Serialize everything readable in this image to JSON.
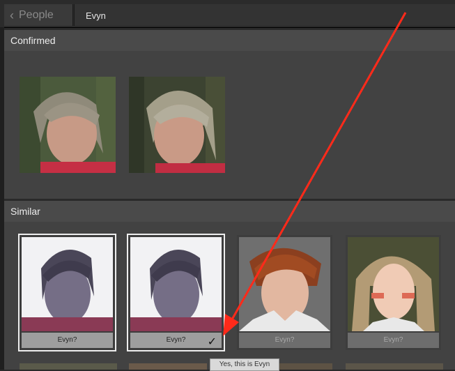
{
  "header": {
    "back_label": "People",
    "title": "Evyn"
  },
  "confirmed": {
    "heading": "Confirmed",
    "count": 2
  },
  "similar": {
    "heading": "Similar",
    "cards": [
      {
        "caption": "Evyn?",
        "state": "selected-grey"
      },
      {
        "caption": "Evyn?",
        "state": "selected-grey-check"
      },
      {
        "caption": "Evyn?",
        "state": "dim"
      },
      {
        "caption": "Evyn?",
        "state": "dim"
      }
    ]
  },
  "tooltip": "Yes, this is Evyn",
  "icons": {
    "back": "chevron-left-icon",
    "check": "checkmark-icon"
  },
  "colors": {
    "annotation_arrow": "#ff2a1a"
  }
}
